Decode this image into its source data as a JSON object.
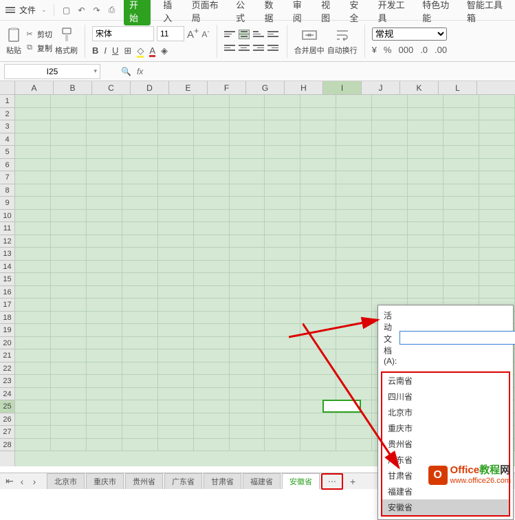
{
  "file_menu": "文件",
  "ribbon_tabs": [
    "开始",
    "插入",
    "页面布局",
    "公式",
    "数据",
    "审阅",
    "视图",
    "安全",
    "开发工具",
    "特色功能",
    "智能工具箱"
  ],
  "ribbon_active_idx": 0,
  "clipboard": {
    "paste": "粘贴",
    "cut": "剪切",
    "copy": "复制",
    "format_painter": "格式刷"
  },
  "font": {
    "name": "宋体",
    "size": "11",
    "increase": "A",
    "decrease": "A"
  },
  "merge_center": "合并居中",
  "wrap_text": "自动换行",
  "number_format": "常规",
  "nf_symbols": [
    "¥",
    "%",
    "000",
    ".0",
    ".00"
  ],
  "namebox_value": "I25",
  "columns": [
    "A",
    "B",
    "C",
    "D",
    "E",
    "F",
    "G",
    "H",
    "I",
    "J",
    "K",
    "L"
  ],
  "rows": [
    "1",
    "2",
    "3",
    "4",
    "5",
    "6",
    "7",
    "8",
    "9",
    "10",
    "11",
    "12",
    "13",
    "14",
    "15",
    "16",
    "17",
    "18",
    "19",
    "20",
    "21",
    "22",
    "23",
    "24",
    "25",
    "26",
    "27",
    "28"
  ],
  "active_col_idx": 8,
  "active_row_idx": 24,
  "sheet_tabs": [
    "北京市",
    "重庆市",
    "贵州省",
    "广东省",
    "甘肃省",
    "福建省",
    "安徽省"
  ],
  "sheet_tabs_active_idx": 6,
  "popup": {
    "label": "活动文档(A):",
    "items": [
      "云南省",
      "四川省",
      "北京市",
      "重庆市",
      "贵州省",
      "广东省",
      "甘肃省",
      "福建省",
      "安徽省"
    ],
    "current_idx": 8
  },
  "watermark": {
    "title_a": "Office",
    "title_b": "教程",
    "title_c": "网",
    "url": "www.office26.com"
  }
}
